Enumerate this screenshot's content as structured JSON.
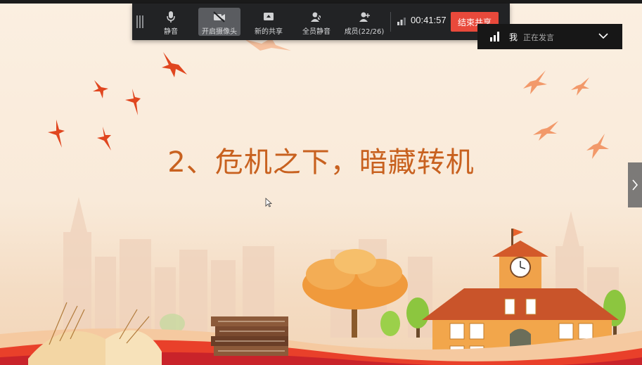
{
  "toolbar": {
    "mute_label": "静音",
    "camera_label": "开启摄像头",
    "new_share_label": "新的共享",
    "mute_all_label": "全员静音",
    "members_label": "成员(22/26)",
    "timer": "00:41:57",
    "end_share_label": "结束共享",
    "icons": [
      "drag-handle-icon",
      "microphone-icon",
      "camera-off-icon",
      "screen-share-icon",
      "mute-all-icon",
      "members-icon",
      "timer-icon"
    ]
  },
  "speaker_panel": {
    "name": "我",
    "status": "正在发言",
    "icons": [
      "volume-bars-icon",
      "chevron-down-icon"
    ]
  },
  "slide": {
    "title": "2、危机之下，暗藏转机",
    "title_color": "#c8611f",
    "background_color": "#f8ecde"
  },
  "colors": {
    "toolbar_bg": "#222325",
    "active_button_bg": "#5a5c60",
    "end_share_bg": "#e8493b",
    "speaker_bg": "#171717",
    "bird_red": "#e0461f",
    "bird_orange": "#f2996a"
  }
}
